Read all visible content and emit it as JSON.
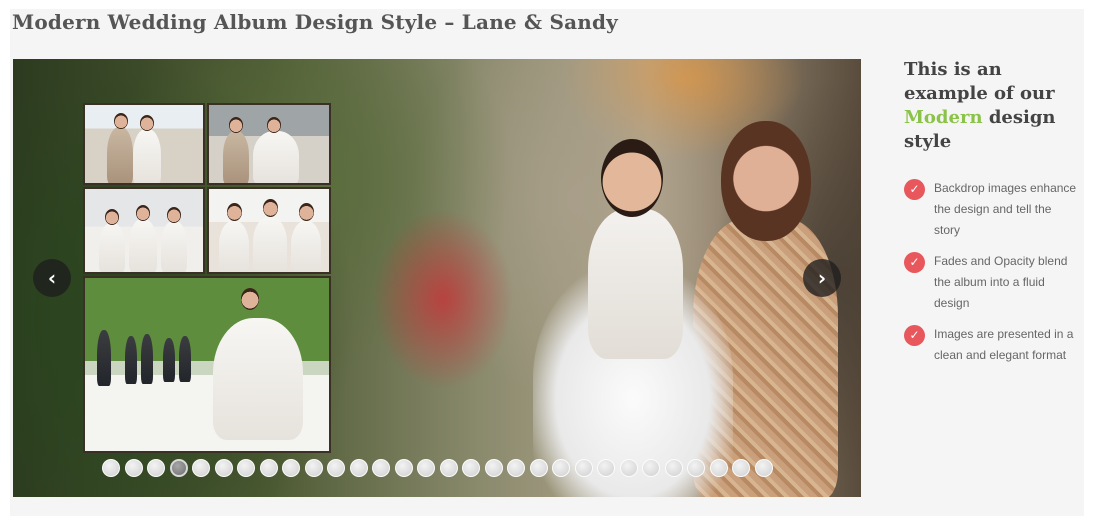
{
  "title": "Modern Wedding Album Design Style – Lane & Sandy",
  "slideshow": {
    "prev_icon": "chevron-left-icon",
    "next_icon": "chevron-right-icon",
    "prev_glyph": "‹",
    "next_glyph": "›",
    "dot_count": 30,
    "active_dot": 4
  },
  "side": {
    "heading_before": "This is an example of our ",
    "heading_accent": "Modern",
    "heading_after": " design style",
    "accent_color": "#8bc34a",
    "check_color": "#e7575c",
    "check_glyph": "✓",
    "features": [
      "Backdrop images enhance the design and tell the story",
      "Fades and Opacity blend the album into a fluid design",
      "Images are presented in a clean and elegant format"
    ]
  }
}
